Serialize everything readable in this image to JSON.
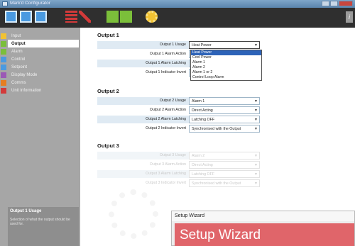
{
  "window": {
    "title": "Mark'd Configurator"
  },
  "toolbar": {
    "buttons": [
      {
        "icon": "new-file-icon"
      },
      {
        "icon": "open-file-icon"
      },
      {
        "icon": "save-icon"
      },
      {
        "icon": "list-icon"
      },
      {
        "icon": "clear-icon"
      },
      {
        "icon": "upload-icon"
      },
      {
        "icon": "download-icon"
      },
      {
        "icon": "settings-gear-icon"
      }
    ],
    "info_label": "i"
  },
  "sidebar": {
    "items": [
      {
        "label": "Input",
        "color": "#f1c232"
      },
      {
        "label": "Output",
        "color": "#7bbf3a"
      },
      {
        "label": "Alarm",
        "color": "#7bbf3a"
      },
      {
        "label": "Control",
        "color": "#4a9ae0"
      },
      {
        "label": "Setpoint",
        "color": "#4a9ae0"
      },
      {
        "label": "Display Mode",
        "color": "#9b59b6"
      },
      {
        "label": "Comms",
        "color": "#e67e22"
      },
      {
        "label": "Unit Information",
        "color": "#d33a3a"
      }
    ],
    "active": "Output",
    "help": {
      "title": "Output 1 Usage",
      "body": "Selection of what the output should be used for."
    }
  },
  "output1": {
    "title": "Output 1",
    "rows": [
      {
        "label": "Output 1 Usage",
        "value": "Heat Power"
      },
      {
        "label": "Output 1 Alarm Action",
        "value": ""
      },
      {
        "label": "Output 1 Alarm Latching",
        "value": ""
      },
      {
        "label": "Output 1 Indicator Invert",
        "value": ""
      }
    ],
    "dropdown_options": [
      "Heat Power",
      "Cool Power",
      "Alarm 1",
      "Alarm 2",
      "Alarm 1 or 2",
      "Control Loop Alarm"
    ],
    "dropdown_selected": "Heat Power"
  },
  "output2": {
    "title": "Output 2",
    "rows": [
      {
        "label": "Output 2 Usage",
        "value": "Alarm 1"
      },
      {
        "label": "Output 2 Alarm Action",
        "value": "Direct Acting"
      },
      {
        "label": "Output 2 Alarm Latching",
        "value": "Latching OFF"
      },
      {
        "label": "Output 2 Indicator Invert",
        "value": "Synchronised with the Output"
      }
    ]
  },
  "output3": {
    "title": "Output 3",
    "rows": [
      {
        "label": "Output 3 Usage",
        "value": "Alarm 2"
      },
      {
        "label": "Output 3 Alarm Action",
        "value": "Direct Acting"
      },
      {
        "label": "Output 3 Alarm Latching",
        "value": "Latching OFF"
      },
      {
        "label": "Output 3 Indicator Invert",
        "value": "Synchronised with the Output"
      }
    ]
  },
  "wizard": {
    "window_title": "Setup Wizard",
    "banner_title": "Setup Wizard"
  }
}
